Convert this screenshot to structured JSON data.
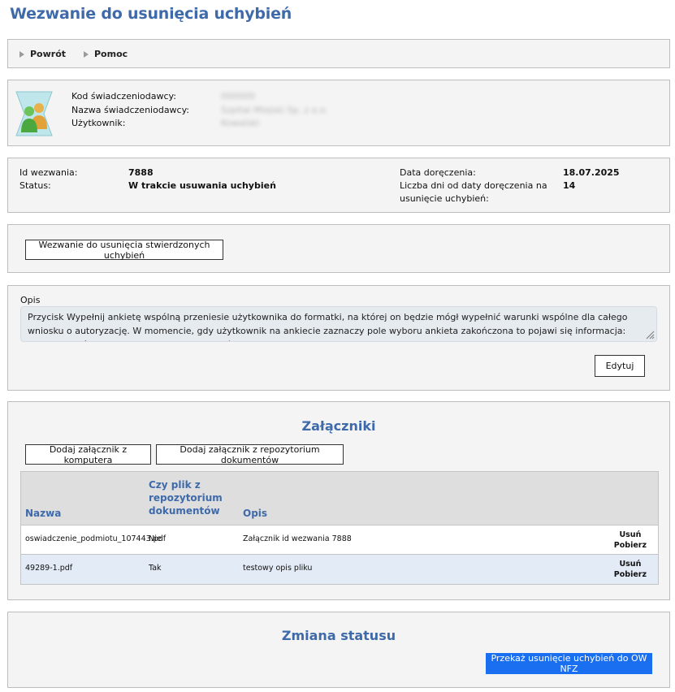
{
  "page": {
    "title": "Wezwanie do usunięcia uchybień"
  },
  "toolbar": {
    "back_label": "Powrót",
    "help_label": "Pomoc"
  },
  "provider": {
    "labels": [
      "Kod świadczeniodawcy:",
      "Nazwa świadczeniodawcy:",
      "Użytkownik:"
    ],
    "values": [
      "000000",
      "Szpital Miejski Sp. z o.o.",
      "Kowalski"
    ],
    "values_obscured": true
  },
  "summary": {
    "id_label": "Id wezwania:",
    "id_value": "7888",
    "status_label": "Status:",
    "status_value": "W trakcie usuwania uchybień",
    "delivery_label": "Data doręczenia:",
    "delivery_value": "18.07.2025",
    "days_label_line1": "Liczba dni od daty doręczenia na",
    "days_label_line2": "usunięcie uchybień:",
    "days_value": "14"
  },
  "letter": {
    "button_label": "Wezwanie do usunięcia stwierdzonych uchybień"
  },
  "opis": {
    "label": "Opis",
    "text": "Przycisk Wypełnij ankietę wspólną przeniesie użytkownika do formatki, na której on będzie mógł wypełnić warunki wspólne dla całego wniosku o autoryzację. W momencie, gdy użytkownik na ankiecie zaznaczy pole wyboru ankieta zakończona to pojawi się informacja: Ankieta wspólna została oznaczona jako ukończona.",
    "edit_label": "Edytuj"
  },
  "attachments": {
    "title": "Załączniki",
    "add_computer_label": "Dodaj załącznik z komputera",
    "add_repo_label": "Dodaj załącznik z repozytorium dokumentów",
    "columns": {
      "name": "Nazwa",
      "repo_line1": "Czy plik z",
      "repo_line2": "repozytorium",
      "repo_line3": "dokumentów",
      "desc": "Opis"
    },
    "rows": [
      {
        "name": "oswiadczenie_podmiotu_107443.pdf",
        "repo": "Nie",
        "desc": "Załącznik id wezwania 7888",
        "delete": "Usuń",
        "download": "Pobierz"
      },
      {
        "name": "49289-1.pdf",
        "repo": "Tak",
        "desc": "testowy opis pliku",
        "delete": "Usuń",
        "download": "Pobierz"
      }
    ]
  },
  "status_change": {
    "title": "Zmiana statusu",
    "submit_label": "Przekaż usunięcie uchybień do OW NFZ"
  },
  "colors": {
    "accent": "#3f6aaa",
    "primary_button": "#1a6ff0",
    "panel_bg": "#f4f4f4",
    "row_alt": "#e3ebf6"
  }
}
